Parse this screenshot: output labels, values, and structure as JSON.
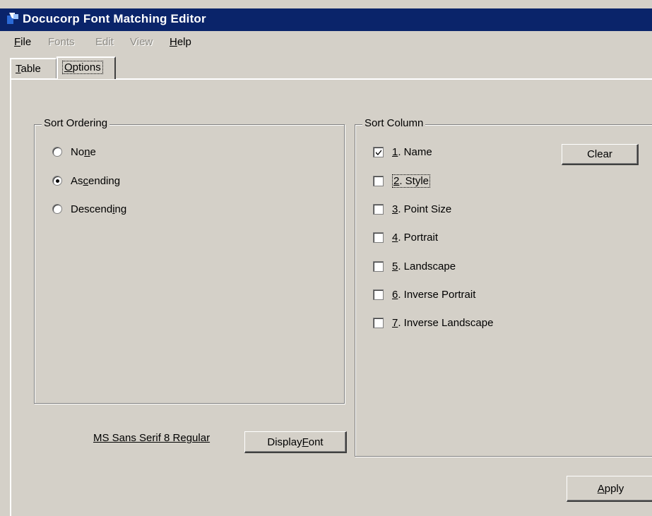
{
  "window": {
    "title": "Docucorp Font Matching Editor"
  },
  "menu": {
    "file": {
      "label": "File",
      "mnemonic": "F",
      "rest": "ile"
    },
    "fonts": {
      "label": "Fonts"
    },
    "edit": {
      "label": "Edit"
    },
    "view": {
      "label": "View"
    },
    "help": {
      "label": "Help",
      "mnemonic": "H",
      "rest": "elp"
    }
  },
  "tabs": {
    "table": {
      "mnemonic": "T",
      "rest": "able"
    },
    "options": {
      "mnemonic": "O",
      "rest": "ptions",
      "selected": true
    }
  },
  "sort_ordering": {
    "label": "Sort Ordering",
    "options": [
      {
        "pre": "No",
        "mnemonic": "n",
        "post": "e",
        "selected": false
      },
      {
        "pre": "As",
        "mnemonic": "c",
        "post": "ending",
        "selected": true
      },
      {
        "pre": "Descend",
        "mnemonic": "i",
        "post": "ng",
        "selected": false
      }
    ]
  },
  "sort_column": {
    "label": "Sort Column",
    "clear_label": "Clear",
    "items": [
      {
        "num": "1",
        "text": ". Name",
        "checked": true
      },
      {
        "num": "2",
        "text": ". Style",
        "checked": false,
        "focused": true
      },
      {
        "num": "3",
        "text": ". Point Size",
        "checked": false
      },
      {
        "num": "4",
        "text": ". Portrait",
        "checked": false
      },
      {
        "num": "5",
        "text": ". Landscape",
        "checked": false
      },
      {
        "num": "6",
        "text": ". Inverse Portrait",
        "checked": false
      },
      {
        "num": "7",
        "text": ". Inverse Landscape",
        "checked": false
      }
    ]
  },
  "display_font": {
    "current_font": "MS Sans Serif  8  Regular",
    "button_pre": "Display ",
    "button_mnemonic": "F",
    "button_post": "ont"
  },
  "apply": {
    "pre": "",
    "mnemonic": "A",
    "post": "pply"
  }
}
